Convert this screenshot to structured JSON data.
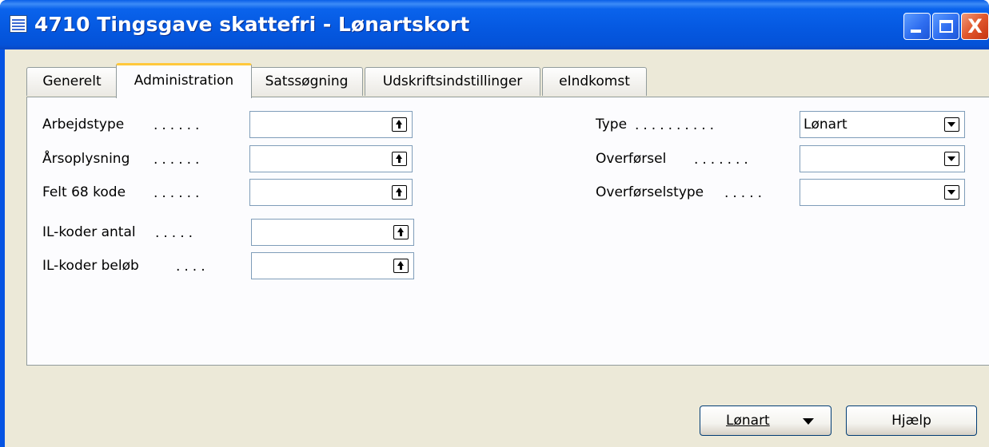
{
  "window": {
    "title": "4710 Tingsgave skattefri - Lønartskort",
    "close_glyph": "X"
  },
  "tabs": [
    {
      "label": "Generelt",
      "active": false
    },
    {
      "label": "Administration",
      "active": true
    },
    {
      "label": "Satssøgning",
      "active": false
    },
    {
      "label": "Udskriftsindstillinger",
      "active": false
    },
    {
      "label": "eIndkomst",
      "active": false
    }
  ],
  "left_fields": [
    {
      "label": "Arbejdstype",
      "value": ""
    },
    {
      "label": "Årsoplysning",
      "value": ""
    },
    {
      "label": "Felt 68 kode",
      "value": ""
    },
    {
      "label": "IL-koder antal",
      "value": ""
    },
    {
      "label": "IL-koder beløb",
      "value": ""
    }
  ],
  "right_fields": [
    {
      "label": "Type",
      "value": "Lønart"
    },
    {
      "label": "Overførsel",
      "value": ""
    },
    {
      "label": "Overførselstype",
      "value": ""
    }
  ],
  "buttons": {
    "lonart": "Lønart",
    "help": "Hjælp"
  },
  "icons": {
    "title": "table-icon",
    "lookup": "up-arrow-icon",
    "dropdown": "chevron-down-icon"
  }
}
